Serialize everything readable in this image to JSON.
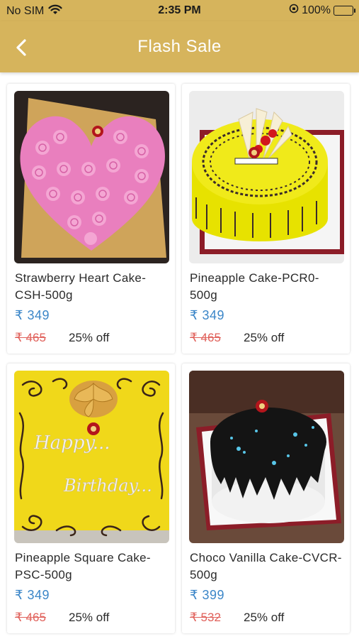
{
  "status_bar": {
    "carrier": "No SIM",
    "time": "2:35 PM",
    "battery": "100%",
    "battery_level": 1.0
  },
  "header": {
    "title": "Flash Sale",
    "back_icon": "chevron-left-icon"
  },
  "colors": {
    "header_bg": "#d6b45c",
    "price": "#3b86c8",
    "old_price": "#e0605a"
  },
  "products": [
    {
      "name": "Strawberry Heart Cake-CSH-500g",
      "price": "₹ 349",
      "old_price": "₹ 465",
      "discount": "25% off",
      "image": "pink-heart-rosette-cake"
    },
    {
      "name": "Pineapple Cake-PCR0-500g",
      "price": "₹ 349",
      "old_price": "₹ 465",
      "discount": "25% off",
      "image": "yellow-round-pineapple-cake"
    },
    {
      "name": "Pineapple Square Cake-PSC-500g",
      "price": "₹ 349",
      "old_price": "₹ 465",
      "discount": "25% off",
      "image": "yellow-square-happy-birthday-cake"
    },
    {
      "name": "Choco Vanilla Cake-CVCR-500g",
      "price": "₹ 399",
      "old_price": "₹ 532",
      "discount": "25% off",
      "image": "chocolate-round-cake"
    }
  ]
}
